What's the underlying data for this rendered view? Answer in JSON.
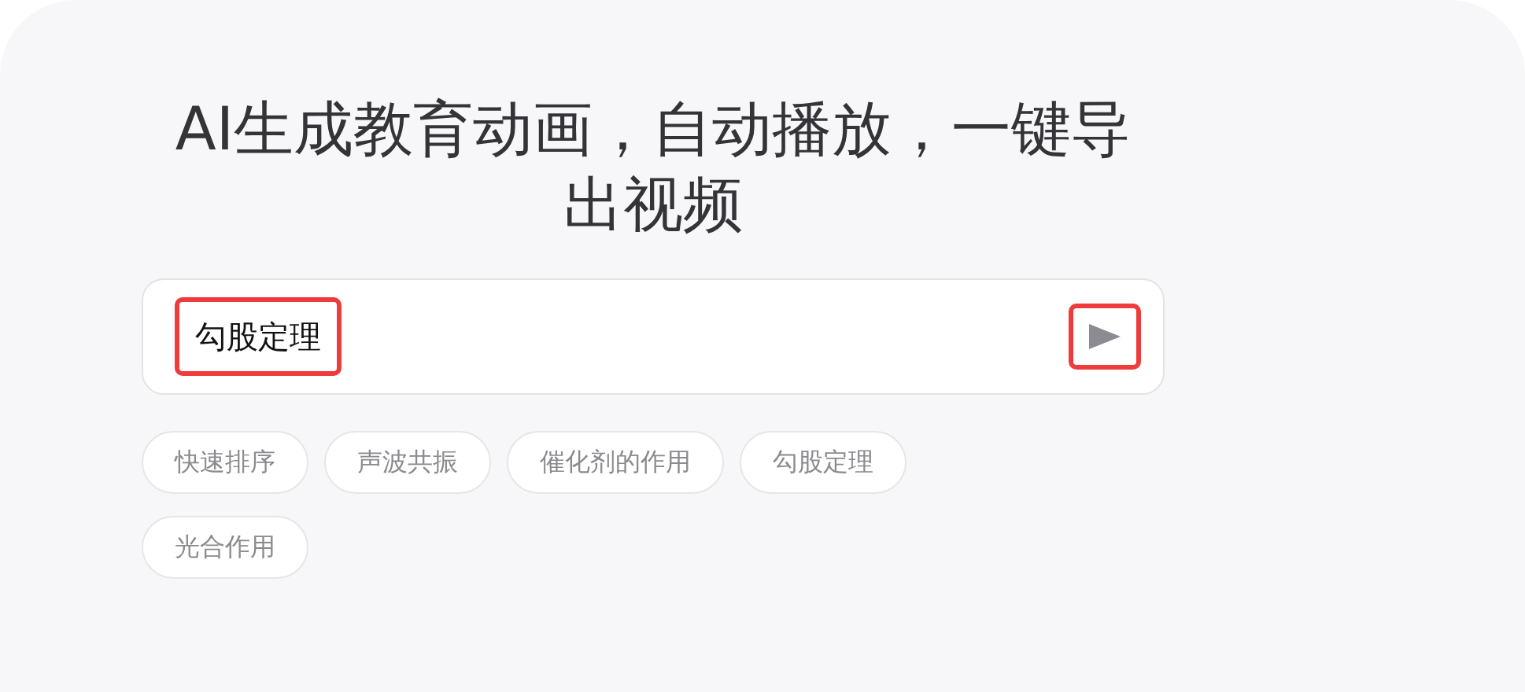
{
  "title": "AI生成教育动画，自动播放，一键导出视频",
  "input": {
    "value": "勾股定理",
    "highlighted": true
  },
  "send_button": {
    "highlighted": true
  },
  "suggestions": [
    {
      "label": "快速排序"
    },
    {
      "label": "声波共振"
    },
    {
      "label": "催化剂的作用"
    },
    {
      "label": "勾股定理"
    },
    {
      "label": "光合作用"
    }
  ]
}
